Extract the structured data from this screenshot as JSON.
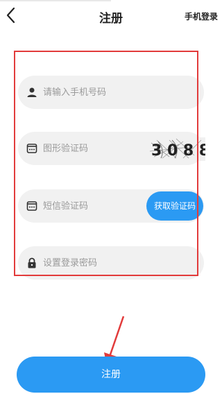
{
  "header": {
    "title": "注册",
    "right_link": "手机登录",
    "back_icon": "chevron-left-icon"
  },
  "form": {
    "phone": {
      "placeholder": "请输入手机号码",
      "icon": "user-icon"
    },
    "captcha": {
      "placeholder": "图形验证码",
      "icon": "message-dots-icon",
      "code": "3 0 8 8"
    },
    "sms": {
      "placeholder": "短信验证码",
      "icon": "message-dots-icon",
      "button_label": "获取验证码"
    },
    "password": {
      "placeholder": "设置登录密码",
      "icon": "lock-icon"
    }
  },
  "submit": {
    "label": "注册"
  },
  "colors": {
    "accent": "#2b9af3",
    "highlight": "#e23b3b",
    "field_bg": "#f1f1f1"
  }
}
